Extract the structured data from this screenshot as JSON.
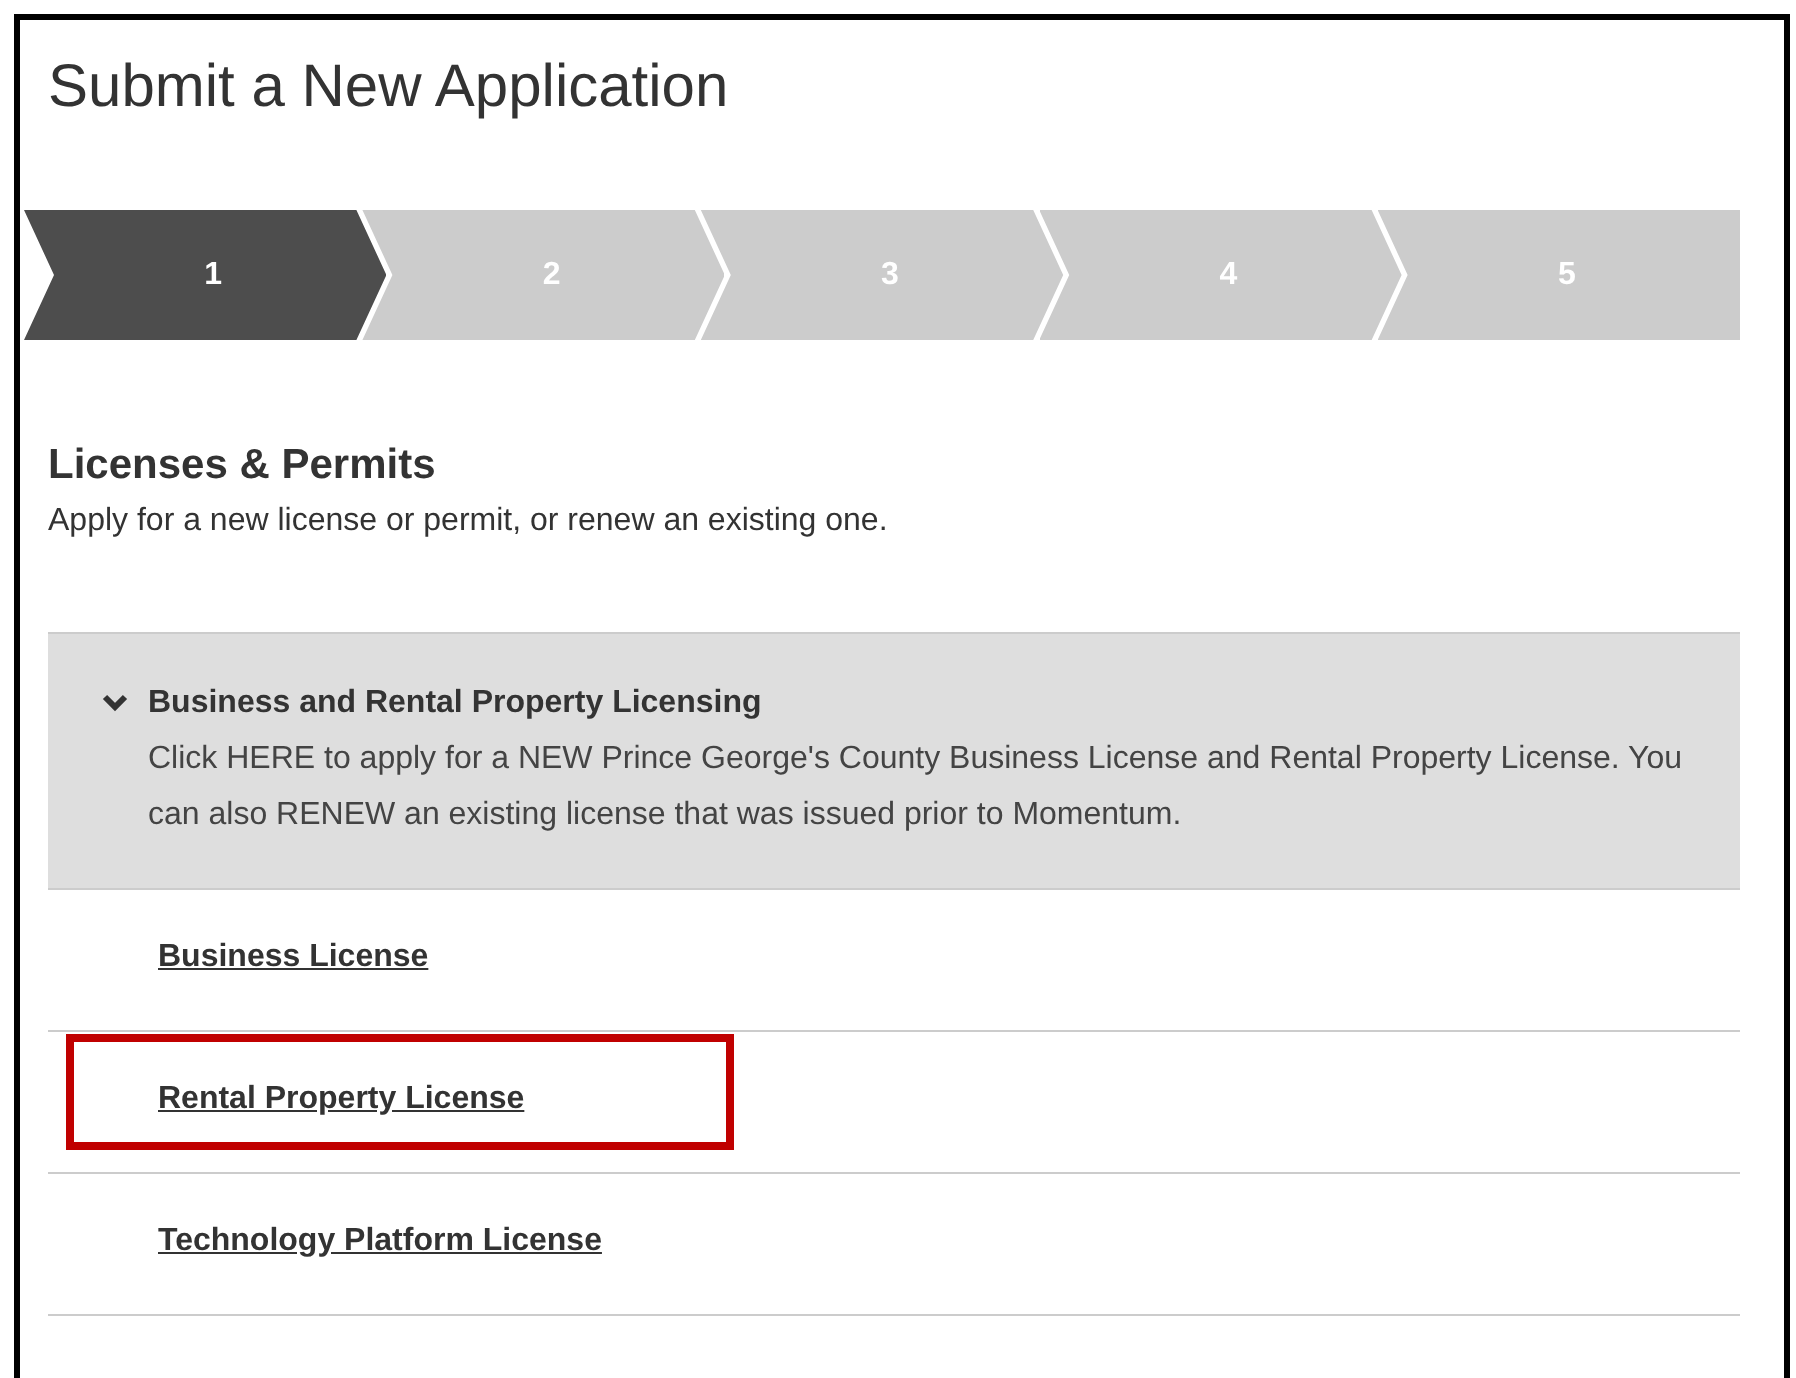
{
  "page": {
    "title": "Submit a New Application"
  },
  "steps": [
    {
      "label": "1",
      "selected": true
    },
    {
      "label": "2",
      "selected": false
    },
    {
      "label": "3",
      "selected": false
    },
    {
      "label": "4",
      "selected": false
    },
    {
      "label": "5",
      "selected": false
    }
  ],
  "section": {
    "heading": "Licenses & Permits",
    "description": "Apply for a new license or permit, or renew an existing one."
  },
  "category": {
    "title": "Business and Rental Property Licensing",
    "expanded": true,
    "description": "Click HERE to apply for a NEW Prince George's County Business License and Rental Property License. You can also RENEW an existing license that was issued prior to Momentum."
  },
  "links": [
    {
      "label": "Business License",
      "highlighted": false
    },
    {
      "label": "Rental Property License",
      "highlighted": true
    },
    {
      "label": "Technology Platform License",
      "highlighted": false
    }
  ]
}
